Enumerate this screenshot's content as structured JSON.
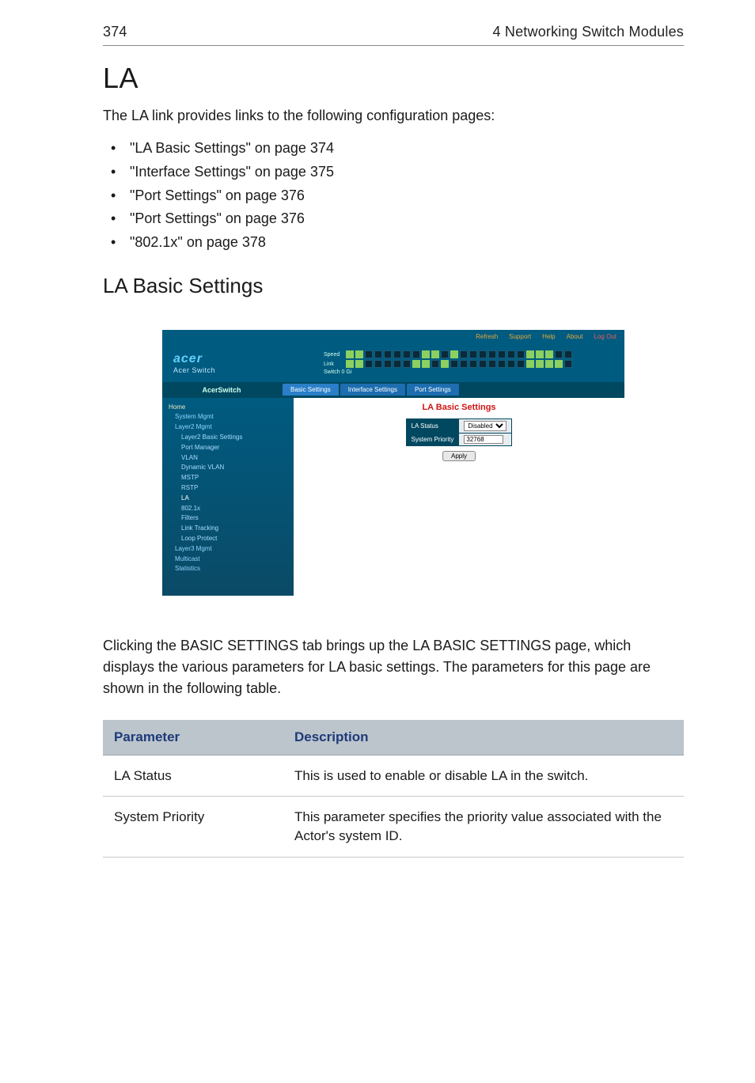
{
  "header": {
    "page_number": "374",
    "section_title": "4 Networking Switch Modules"
  },
  "h1": "LA",
  "intro": "The LA link provides links to the following configuration pages:",
  "bullets": [
    "\"LA Basic Settings\" on page 374",
    "\"Interface Settings\" on page 375",
    "\"Port Settings\" on page 376",
    "\"Port Settings\" on page 376",
    "\"802.1x\" on page 378"
  ],
  "h2": "LA Basic Settings",
  "screenshot": {
    "topbar": {
      "refresh": "Refresh",
      "support": "Support",
      "help": "Help",
      "about": "About",
      "logout": "Log Out"
    },
    "brand": {
      "title": "acer",
      "sub": "Acer Switch"
    },
    "ports": {
      "row1_label": "Speed",
      "row2_label": "Link",
      "row3_label": "Switch 0 Gi"
    },
    "nav_title": "AcerSwitch",
    "tabs": [
      "Basic Settings",
      "Interface Settings",
      "Port Settings"
    ],
    "nav": [
      {
        "t": "Home",
        "cls": "top"
      },
      {
        "t": "System Mgmt",
        "cls": "sub"
      },
      {
        "t": "Layer2 Mgmt",
        "cls": "sub"
      },
      {
        "t": "Layer2 Basic Settings",
        "cls": "subsub"
      },
      {
        "t": "Port Manager",
        "cls": "subsub"
      },
      {
        "t": "VLAN",
        "cls": "subsub"
      },
      {
        "t": "Dynamic VLAN",
        "cls": "subsub"
      },
      {
        "t": "MSTP",
        "cls": "subsub"
      },
      {
        "t": "RSTP",
        "cls": "subsub"
      },
      {
        "t": "LA",
        "cls": "subsub hl"
      },
      {
        "t": "802.1x",
        "cls": "subsub"
      },
      {
        "t": "Filters",
        "cls": "subsub"
      },
      {
        "t": "Link Tracking",
        "cls": "subsub"
      },
      {
        "t": "Loop Protect",
        "cls": "subsub"
      },
      {
        "t": "Layer3 Mgmt",
        "cls": "sub"
      },
      {
        "t": "Multicast",
        "cls": "sub"
      },
      {
        "t": "Statistics",
        "cls": "sub"
      }
    ],
    "content": {
      "title": "LA Basic Settings",
      "rows": [
        {
          "k": "LA Status",
          "v_type": "select",
          "v": "Disabled"
        },
        {
          "k": "System Priority",
          "v_type": "input",
          "v": "32768"
        }
      ],
      "apply": "Apply"
    }
  },
  "afterfig": {
    "pre1": "Clicking the ",
    "sc1": "BASIC SETTINGS",
    "mid1": " tab brings up the ",
    "sc2": "LA BASIC SETTINGS",
    "post": " page, which displays the various parameters for LA basic settings. The parameters for this page are shown in the following table."
  },
  "param_table": {
    "columns": [
      "Parameter",
      "Description"
    ],
    "rows": [
      {
        "param": "LA Status",
        "desc": "This is used to enable or disable LA in the switch."
      },
      {
        "param": "System Priority",
        "desc": "This parameter specifies the priority value associated with the Actor's system ID."
      }
    ]
  }
}
